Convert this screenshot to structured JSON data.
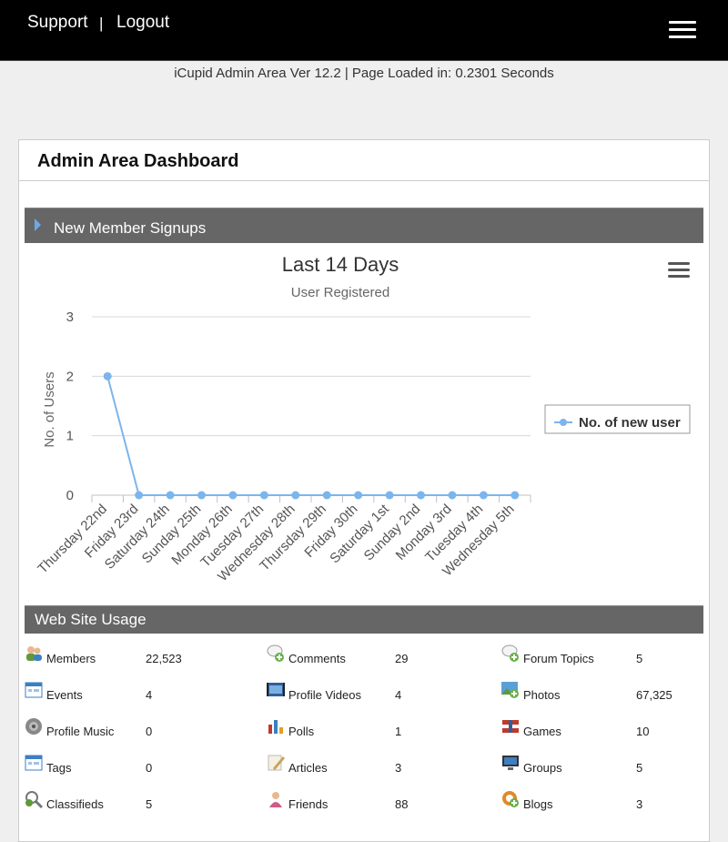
{
  "header": {
    "support_label": "Support",
    "separator": "|",
    "logout_label": "Logout"
  },
  "version_line": "iCupid Admin Area Ver 12.2 | Page Loaded in: 0.2301 Seconds",
  "dashboard": {
    "title": "Admin Area Dashboard",
    "signups_section_label": "New Member Signups",
    "usage_section_label": "Web Site Usage"
  },
  "chart_data": {
    "type": "line",
    "title": "Last 14 Days",
    "subtitle": "User Registered",
    "xlabel": "",
    "ylabel": "No. of Users",
    "categories": [
      "Thursday 22nd",
      "Friday 23rd",
      "Saturday 24th",
      "Sunday 25th",
      "Monday 26th",
      "Tuesday 27th",
      "Wednesday 28th",
      "Thursday 29th",
      "Friday 30th",
      "Saturday 1st",
      "Sunday 2nd",
      "Monday 3rd",
      "Tuesday 4th",
      "Wednesday 5th"
    ],
    "series": [
      {
        "name": "No. of new user",
        "values": [
          2,
          0,
          0,
          0,
          0,
          0,
          0,
          0,
          0,
          0,
          0,
          0,
          0,
          0
        ],
        "color": "#7cb5ec"
      }
    ],
    "ylim": [
      0,
      3
    ],
    "yticks": [
      0,
      1,
      2,
      3
    ],
    "grid": true,
    "legend_position": "right"
  },
  "usage_stats": [
    {
      "label": "Members",
      "value": "22,523",
      "icon": "members-icon",
      "color": "#5c9a3a"
    },
    {
      "label": "Comments",
      "value": "29",
      "icon": "comments-icon",
      "color": "#6ab04c"
    },
    {
      "label": "Forum Topics",
      "value": "5",
      "icon": "forum-topics-icon",
      "color": "#6ab04c"
    },
    {
      "label": "Events",
      "value": "4",
      "icon": "events-icon",
      "color": "#3d7fc1"
    },
    {
      "label": "Profile Videos",
      "value": "4",
      "icon": "profile-videos-icon",
      "color": "#2f5f9a"
    },
    {
      "label": "Photos",
      "value": "67,325",
      "icon": "photos-icon",
      "color": "#5aa0d8"
    },
    {
      "label": "Profile Music",
      "value": "0",
      "icon": "profile-music-icon",
      "color": "#888888"
    },
    {
      "label": "Polls",
      "value": "1",
      "icon": "polls-icon",
      "color": "#c0392b"
    },
    {
      "label": "Games",
      "value": "10",
      "icon": "games-icon",
      "color": "#c0392b"
    },
    {
      "label": "Tags",
      "value": "0",
      "icon": "tags-icon",
      "color": "#3d7fc1"
    },
    {
      "label": "Articles",
      "value": "3",
      "icon": "articles-icon",
      "color": "#c8a060"
    },
    {
      "label": "Groups",
      "value": "5",
      "icon": "groups-icon",
      "color": "#3d7fc1"
    },
    {
      "label": "Classifieds",
      "value": "5",
      "icon": "classifieds-icon",
      "color": "#5c9a3a"
    },
    {
      "label": "Friends",
      "value": "88",
      "icon": "friends-icon",
      "color": "#d05a8a"
    },
    {
      "label": "Blogs",
      "value": "3",
      "icon": "blogs-icon",
      "color": "#e08a2a"
    }
  ]
}
